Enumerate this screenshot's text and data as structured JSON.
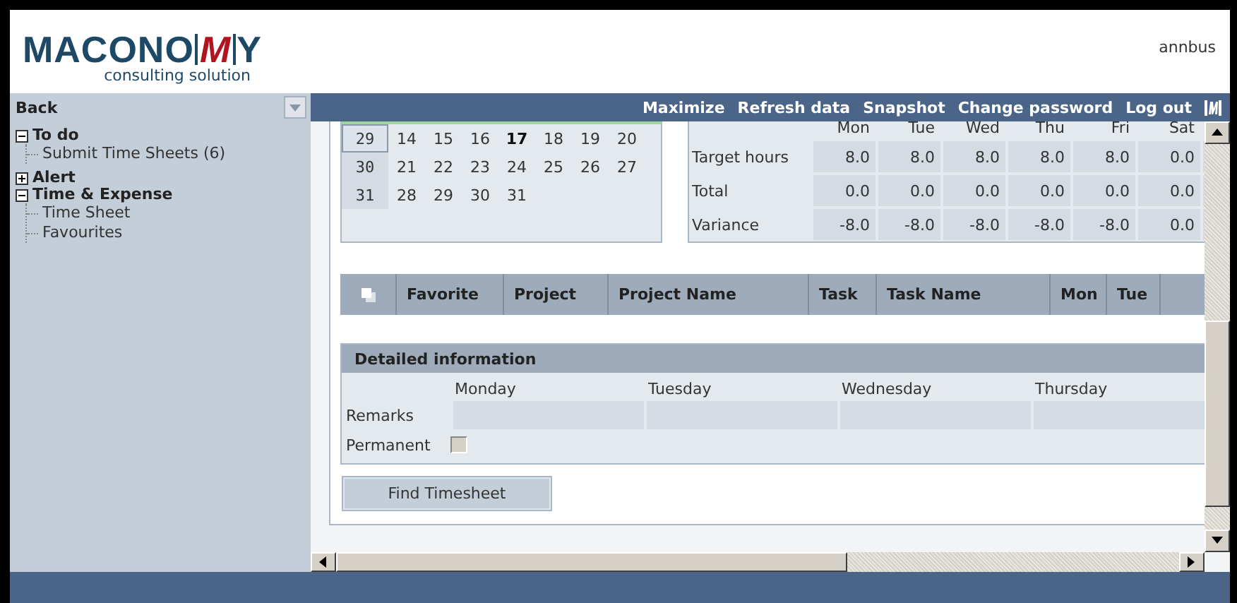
{
  "header": {
    "logo": {
      "left": "MACONO",
      "mark": "M",
      "right": "Y",
      "tagline": "consulting solution"
    },
    "user": "annbus"
  },
  "toolbar": {
    "back": "Back",
    "actions": [
      "Maximize",
      "Refresh data",
      "Snapshot",
      "Change password",
      "Log out"
    ]
  },
  "sidebar": {
    "items": [
      {
        "label": "To do",
        "expanded": true,
        "children": [
          {
            "label": "Submit Time Sheets (6)"
          }
        ]
      },
      {
        "label": "Alert",
        "expanded": false
      },
      {
        "label": "Time & Expense",
        "expanded": true,
        "children": [
          {
            "label": "Time Sheet"
          },
          {
            "label": "Favourites"
          }
        ]
      }
    ]
  },
  "calendar": {
    "weeks": [
      {
        "week": "29",
        "selected": true,
        "days": [
          {
            "label": "14",
            "today": false
          },
          {
            "label": "15",
            "today": false
          },
          {
            "label": "16",
            "today": false
          },
          {
            "label": "17",
            "today": true
          },
          {
            "label": "18",
            "today": false
          },
          {
            "label": "19",
            "today": false
          },
          {
            "label": "20",
            "today": false
          }
        ]
      },
      {
        "week": "30",
        "selected": false,
        "days": [
          {
            "label": "21",
            "today": false
          },
          {
            "label": "22",
            "today": false
          },
          {
            "label": "23",
            "today": false
          },
          {
            "label": "24",
            "today": false
          },
          {
            "label": "25",
            "today": false
          },
          {
            "label": "26",
            "today": false
          },
          {
            "label": "27",
            "today": false
          }
        ]
      },
      {
        "week": "31",
        "selected": false,
        "days": [
          {
            "label": "28",
            "today": false
          },
          {
            "label": "29",
            "today": false
          },
          {
            "label": "30",
            "today": false
          },
          {
            "label": "31",
            "today": false
          }
        ]
      }
    ]
  },
  "summary": {
    "columns": [
      "Mon",
      "Tue",
      "Wed",
      "Thu",
      "Fri",
      "Sat"
    ],
    "rows": [
      {
        "label": "Target hours",
        "values": [
          "8.0",
          "8.0",
          "8.0",
          "8.0",
          "8.0",
          "0.0"
        ]
      },
      {
        "label": "Total",
        "values": [
          "0.0",
          "0.0",
          "0.0",
          "0.0",
          "0.0",
          "0.0"
        ]
      },
      {
        "label": "Variance",
        "values": [
          "-8.0",
          "-8.0",
          "-8.0",
          "-8.0",
          "-8.0",
          "0.0"
        ]
      }
    ]
  },
  "table": {
    "columns": [
      "Favorite",
      "Project",
      "Project Name",
      "Task",
      "Task Name",
      "Mon",
      "Tue"
    ]
  },
  "details": {
    "title": "Detailed information",
    "days": [
      "Monday",
      "Tuesday",
      "Wednesday",
      "Thursday"
    ],
    "remarks_label": "Remarks",
    "permanent_label": "Permanent",
    "permanent": false
  },
  "button": "Find Timesheet"
}
